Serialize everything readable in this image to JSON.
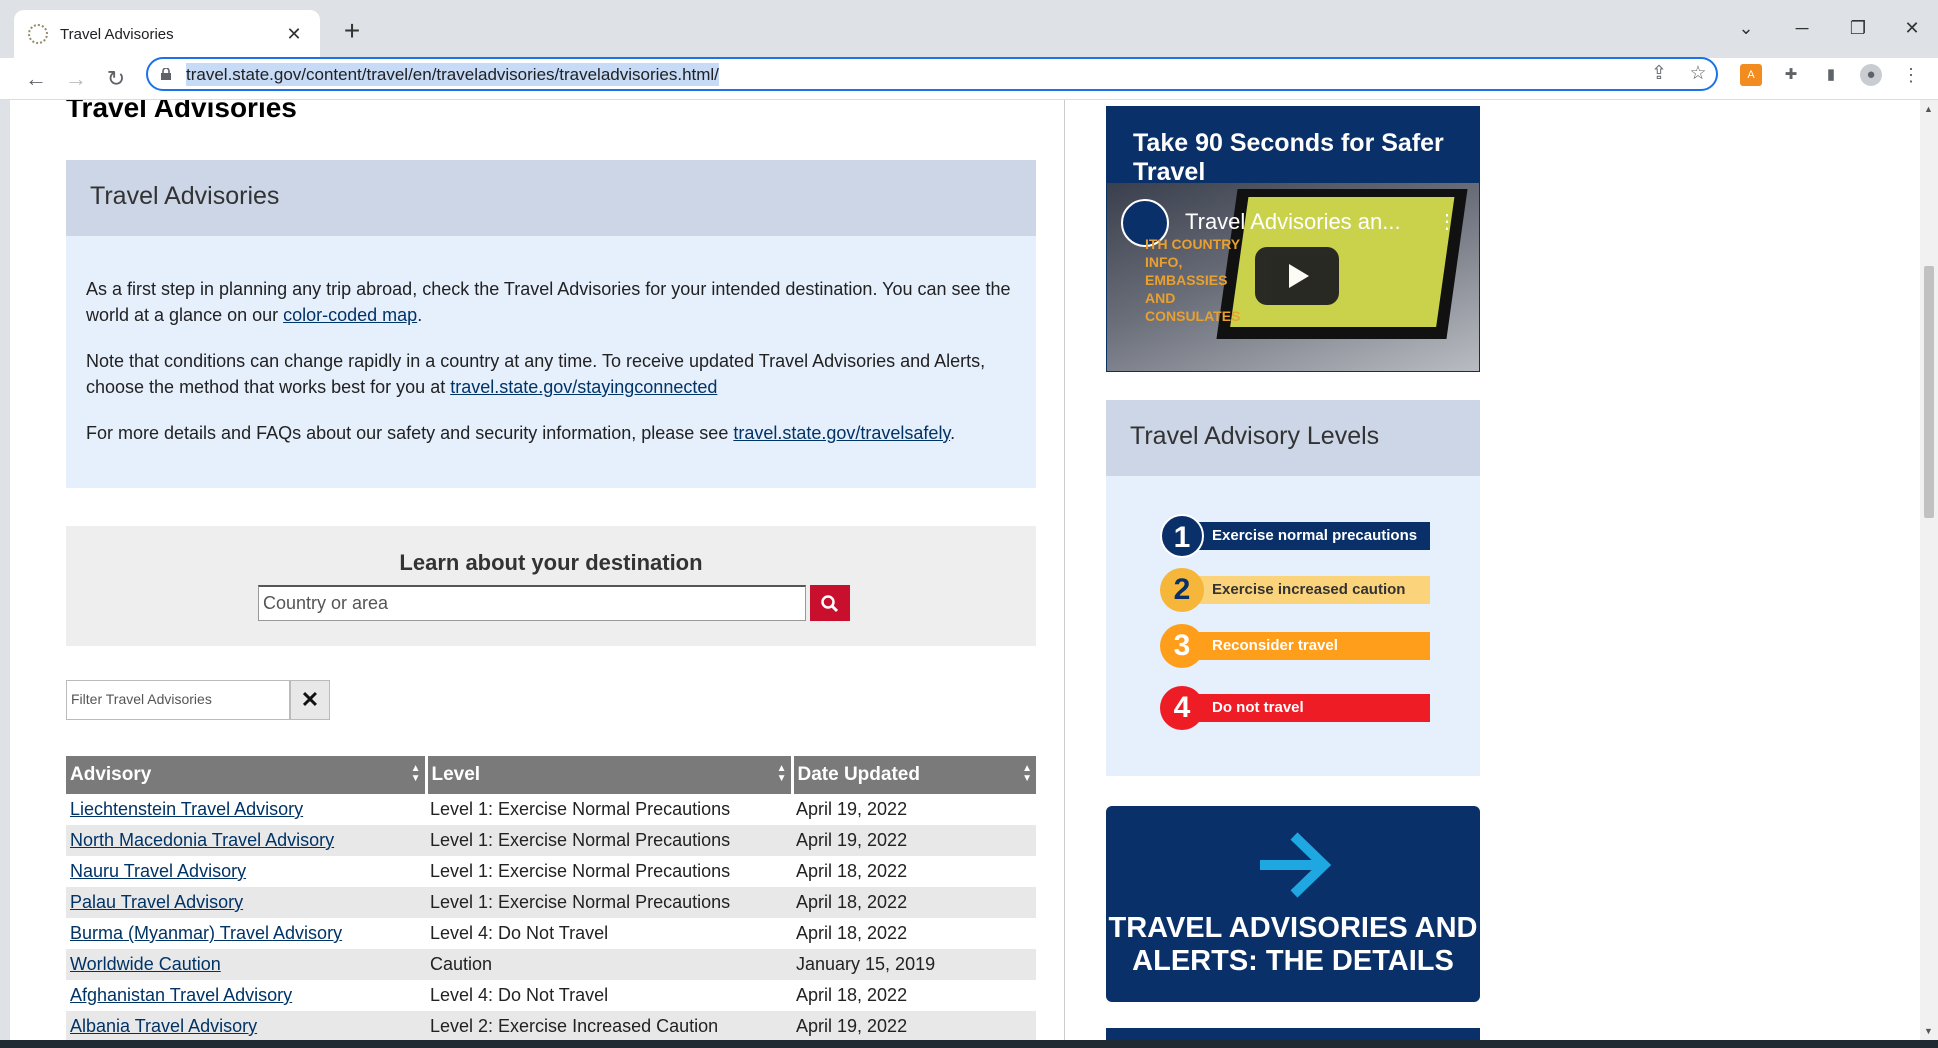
{
  "browser": {
    "tab_title": "Travel Advisories",
    "tab_close": "✕",
    "new_tab": "+",
    "url": "travel.state.gov/content/travel/en/traveladvisories/traveladvisories.html/"
  },
  "page": {
    "heading": "Travel Advisories",
    "info": {
      "title": "Travel Advisories",
      "p1_text": "As a first step in planning any trip abroad, check the Travel Advisories for your intended destination. You can see the world at a glance on our ",
      "p1_link": "color-coded map",
      "p1_end": ".",
      "p2_text": "Note that conditions can change rapidly in a country at any time. To receive updated Travel Advisories and Alerts, choose the method that works best for you at ",
      "p2_link": "travel.state.gov/stayingconnected",
      "p3_text": "For more details and FAQs about our safety and security information, please see ",
      "p3_link": "travel.state.gov/travelsafely",
      "p3_end": "."
    },
    "learn": {
      "title": "Learn about your destination",
      "placeholder": "Country or area"
    },
    "filter": {
      "placeholder": "Filter Travel Advisories",
      "clear": "✕"
    },
    "table": {
      "headers": [
        "Advisory",
        "Level",
        "Date Updated"
      ],
      "rows": [
        {
          "advisory": "Liechtenstein Travel Advisory",
          "level": "Level 1: Exercise Normal Precautions",
          "date": "April 19, 2022"
        },
        {
          "advisory": "North Macedonia Travel Advisory",
          "level": "Level 1: Exercise Normal Precautions",
          "date": "April 19, 2022"
        },
        {
          "advisory": "Nauru Travel Advisory",
          "level": "Level 1: Exercise Normal Precautions",
          "date": "April 18, 2022"
        },
        {
          "advisory": "Palau Travel Advisory",
          "level": "Level 1: Exercise Normal Precautions",
          "date": "April 18, 2022"
        },
        {
          "advisory": "Burma (Myanmar) Travel Advisory",
          "level": "Level 4: Do Not Travel",
          "date": "April 18, 2022"
        },
        {
          "advisory": "Worldwide Caution",
          "level": "Caution",
          "date": "January 15, 2019"
        },
        {
          "advisory": "Afghanistan Travel Advisory",
          "level": "Level 4: Do Not Travel",
          "date": "April 18, 2022"
        },
        {
          "advisory": "Albania Travel Advisory",
          "level": "Level 2: Exercise Increased Caution",
          "date": "April 19, 2022"
        }
      ]
    }
  },
  "sidebar": {
    "video": {
      "title": "Take 90 Seconds for Safer Travel",
      "video_title": "Travel Advisories an...",
      "video_subtitle": "ITH COUNTRY INFO, EMBASSIES AND CONSULATES"
    },
    "levels": {
      "title": "Travel Advisory Levels",
      "items": [
        {
          "num": "1",
          "label": "Exercise normal precautions",
          "color": "#0a3069",
          "text_color": "#ffffff"
        },
        {
          "num": "2",
          "label": "Exercise increased caution",
          "color": "#fbd37a",
          "circle": "#f5b63a",
          "text_color": "#333333"
        },
        {
          "num": "3",
          "label": "Reconsider travel",
          "color": "#ff9e1b",
          "circle": "#ff9e1b",
          "text_color": "#ffffff"
        },
        {
          "num": "4",
          "label": "Do not travel",
          "color": "#ee1c25",
          "circle": "#ee1c25",
          "text_color": "#ffffff"
        }
      ]
    },
    "details": {
      "label": "TRAVEL ADVISORIES AND ALERTS: THE DETAILS"
    }
  },
  "colors": {
    "navy": "#0a3069",
    "link": "#003366",
    "search_red": "#c8102e",
    "accent_blue": "#1a73e8"
  }
}
